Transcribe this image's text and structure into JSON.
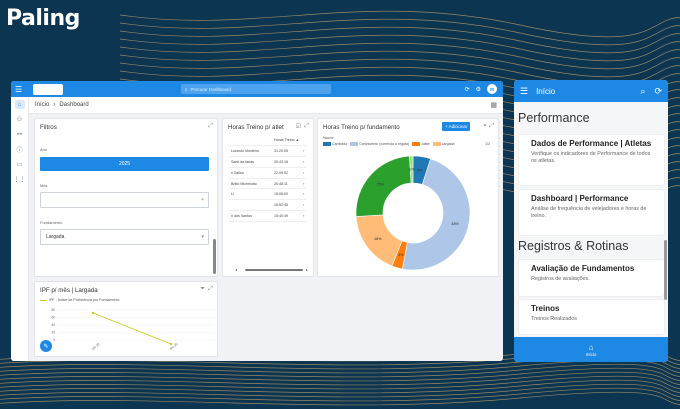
{
  "logo": {
    "text": "Paling"
  },
  "desktop": {
    "search_placeholder": "Procurar Dashboard",
    "avatar": "M",
    "breadcrumb": {
      "home": "Início",
      "sep": "›",
      "current": "Dashboard"
    },
    "filters": {
      "title": "Filtros",
      "ano_label": "Ano",
      "ano_value": "2025",
      "mes_label": "Mês",
      "fundamento_label": "Fundamento",
      "fundamento_value": "Largada"
    },
    "horas_table": {
      "title": "Horas Treino p/ atlet",
      "header": "Horas Treino ▲",
      "rows": [
        {
          "name": "Lucardo Monteiro",
          "hours": "31:20:05"
        },
        {
          "name": "Santi de farias",
          "hours": "20:43:16"
        },
        {
          "name": "n Salles",
          "hours": "22:09:02"
        },
        {
          "name": "Britto Michelotto",
          "hours": "20:48:11"
        },
        {
          "name": "Li",
          "hours": "15:08:00"
        },
        {
          "name": "",
          "hours": "15:52:45"
        },
        {
          "name": "n dos Santos",
          "hours": "15:40:49"
        }
      ]
    },
    "donut": {
      "title": "Horas Treino p/ fundamento",
      "add_button": "+ Adicionar",
      "legend_title": "Nome",
      "page": "1/3"
    },
    "ipf": {
      "title": "IPF p/ mês | Largada",
      "legend": "IPF - Índice de Proficiência por Fundamento",
      "y_ticks": [
        "80",
        "60",
        "40",
        "20",
        "0"
      ],
      "x_ticks": [
        "jan-25",
        "fev-25"
      ]
    }
  },
  "chart_data": {
    "type": "pie",
    "categories": [
      "Cambada",
      "Contravento (correndo a regata)",
      "Jaibe",
      "Largada"
    ],
    "values": [
      5,
      48,
      3,
      18,
      25,
      1
    ],
    "labels": [
      "5%",
      "48%",
      "3%",
      "18%",
      "25%",
      "1%"
    ],
    "colors": [
      "#1f77b4",
      "#aec7e8",
      "#ff7f0e",
      "#ffbb78",
      "#2ca02c",
      "#98df8a"
    ]
  },
  "mobile": {
    "title": "Início",
    "section1": "Performance",
    "cards": [
      {
        "title": "Dados de Performance | Atletas",
        "sub": "Verifique os indicadores de Performance de todos os atletas."
      },
      {
        "title": "Dashboard | Performance",
        "sub": "Análise de frequência de velejadores e horas de treino."
      }
    ],
    "section2": "Registros & Rotinas",
    "cards2": [
      {
        "title": "Avaliação de Fundamentos",
        "sub": "Registros de avaliações."
      },
      {
        "title": "Treinos",
        "sub": "Treinos Realizados"
      }
    ],
    "nav_label": "Início"
  }
}
